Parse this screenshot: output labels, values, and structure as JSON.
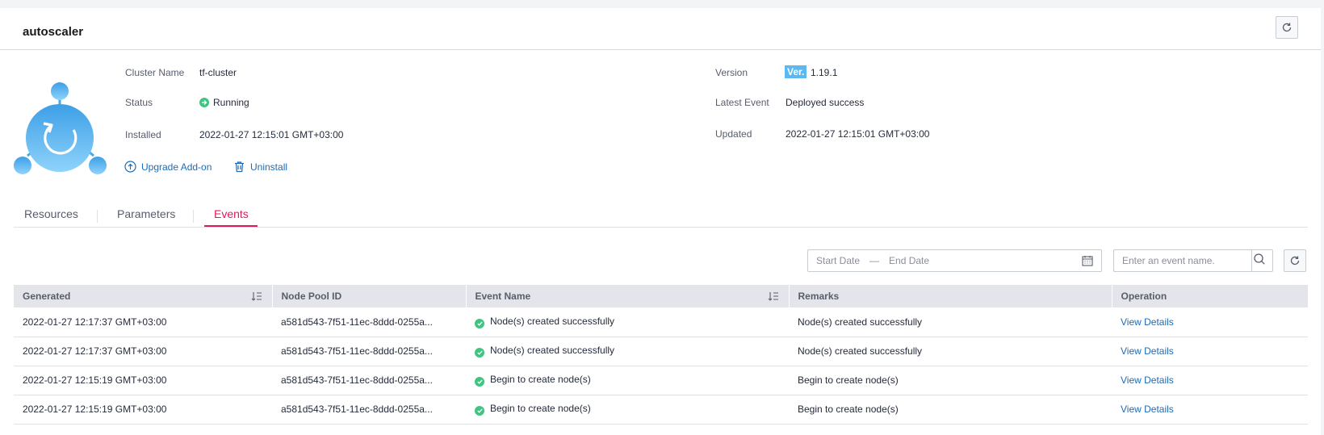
{
  "page": {
    "title": "autoscaler"
  },
  "info": {
    "cluster_name_label": "Cluster Name",
    "cluster_name_value": "tf-cluster",
    "status_label": "Status",
    "status_value": "Running",
    "installed_label": "Installed",
    "installed_value": "2022-01-27 12:15:01 GMT+03:00",
    "version_label": "Version",
    "version_badge": "Ver.",
    "version_value": "1.19.1",
    "latest_event_label": "Latest Event",
    "latest_event_value": "Deployed success",
    "updated_label": "Updated",
    "updated_value": "2022-01-27 12:15:01 GMT+03:00"
  },
  "actions": {
    "upgrade": "Upgrade Add-on",
    "uninstall": "Uninstall"
  },
  "tabs": [
    {
      "label": "Resources",
      "active": false
    },
    {
      "label": "Parameters",
      "active": false
    },
    {
      "label": "Events",
      "active": true
    }
  ],
  "filters": {
    "start_date_placeholder": "Start Date",
    "range_separator": "—",
    "end_date_placeholder": "End Date",
    "search_placeholder": "Enter an event name."
  },
  "table": {
    "columns": [
      "Generated",
      "Node Pool ID",
      "Event Name",
      "Remarks",
      "Operation"
    ],
    "rows": [
      {
        "generated": "2022-01-27 12:17:37 GMT+03:00",
        "node_pool_id": "a581d543-7f51-11ec-8ddd-0255a...",
        "event_name": "Node(s) created successfully",
        "remarks": "Node(s) created successfully",
        "operation": "View Details"
      },
      {
        "generated": "2022-01-27 12:17:37 GMT+03:00",
        "node_pool_id": "a581d543-7f51-11ec-8ddd-0255a...",
        "event_name": "Node(s) created successfully",
        "remarks": "Node(s) created successfully",
        "operation": "View Details"
      },
      {
        "generated": "2022-01-27 12:15:19 GMT+03:00",
        "node_pool_id": "a581d543-7f51-11ec-8ddd-0255a...",
        "event_name": "Begin to create node(s)",
        "remarks": "Begin to create node(s)",
        "operation": "View Details"
      },
      {
        "generated": "2022-01-27 12:15:19 GMT+03:00",
        "node_pool_id": "a581d543-7f51-11ec-8ddd-0255a...",
        "event_name": "Begin to create node(s)",
        "remarks": "Begin to create node(s)",
        "operation": "View Details"
      }
    ]
  },
  "colors": {
    "accent_tab": "#e0185f",
    "link": "#1f6bb5",
    "success": "#3ec57f",
    "badge": "#5cb8f0"
  },
  "icons": [
    "refresh-icon",
    "addon-logo-icon",
    "running-status-icon",
    "upgrade-icon",
    "trash-icon",
    "calendar-icon",
    "search-icon",
    "sort-icon",
    "success-icon"
  ]
}
